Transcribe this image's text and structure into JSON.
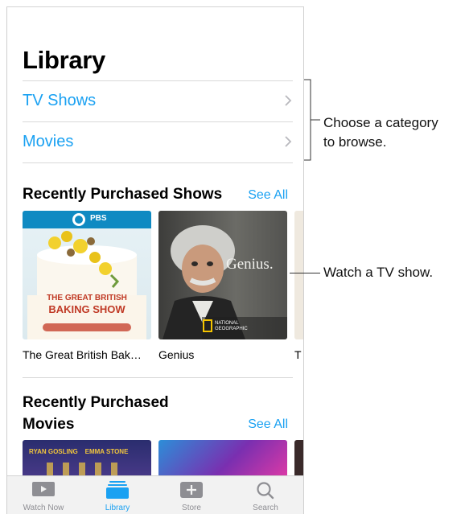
{
  "page_title": "Library",
  "nav_rows": [
    {
      "label": "TV Shows"
    },
    {
      "label": "Movies"
    }
  ],
  "shows_section": {
    "title": "Recently Purchased Shows",
    "see_all": "See All",
    "items": [
      {
        "caption": "The Great British Bak…",
        "art_badge": "PBS",
        "art_text_1": "THE GREAT BRITISH",
        "art_text_2": "BAKING SHOW"
      },
      {
        "caption": "Genius",
        "art_title": "Genius.",
        "art_badge_1": "NATIONAL",
        "art_badge_2": "GEOGRAPHIC"
      },
      {
        "caption": "T"
      }
    ]
  },
  "movies_section": {
    "title_line1": "Recently Purchased",
    "title_line2": "Movies",
    "see_all": "See All",
    "items": [
      {
        "art_text": "RYAN GOSLING    EMMA STONE"
      },
      {}
    ]
  },
  "tabbar": [
    {
      "label": "Watch Now",
      "icon": "watch-now-icon",
      "active": false
    },
    {
      "label": "Library",
      "icon": "library-icon",
      "active": true
    },
    {
      "label": "Store",
      "icon": "store-icon",
      "active": false
    },
    {
      "label": "Search",
      "icon": "search-icon",
      "active": false
    }
  ],
  "callouts": {
    "category_line1": "Choose a category",
    "category_line2": "to browse.",
    "watch": "Watch a TV show."
  },
  "colors": {
    "accent": "#1aa1f2",
    "tab_inactive": "#8e8e93"
  }
}
